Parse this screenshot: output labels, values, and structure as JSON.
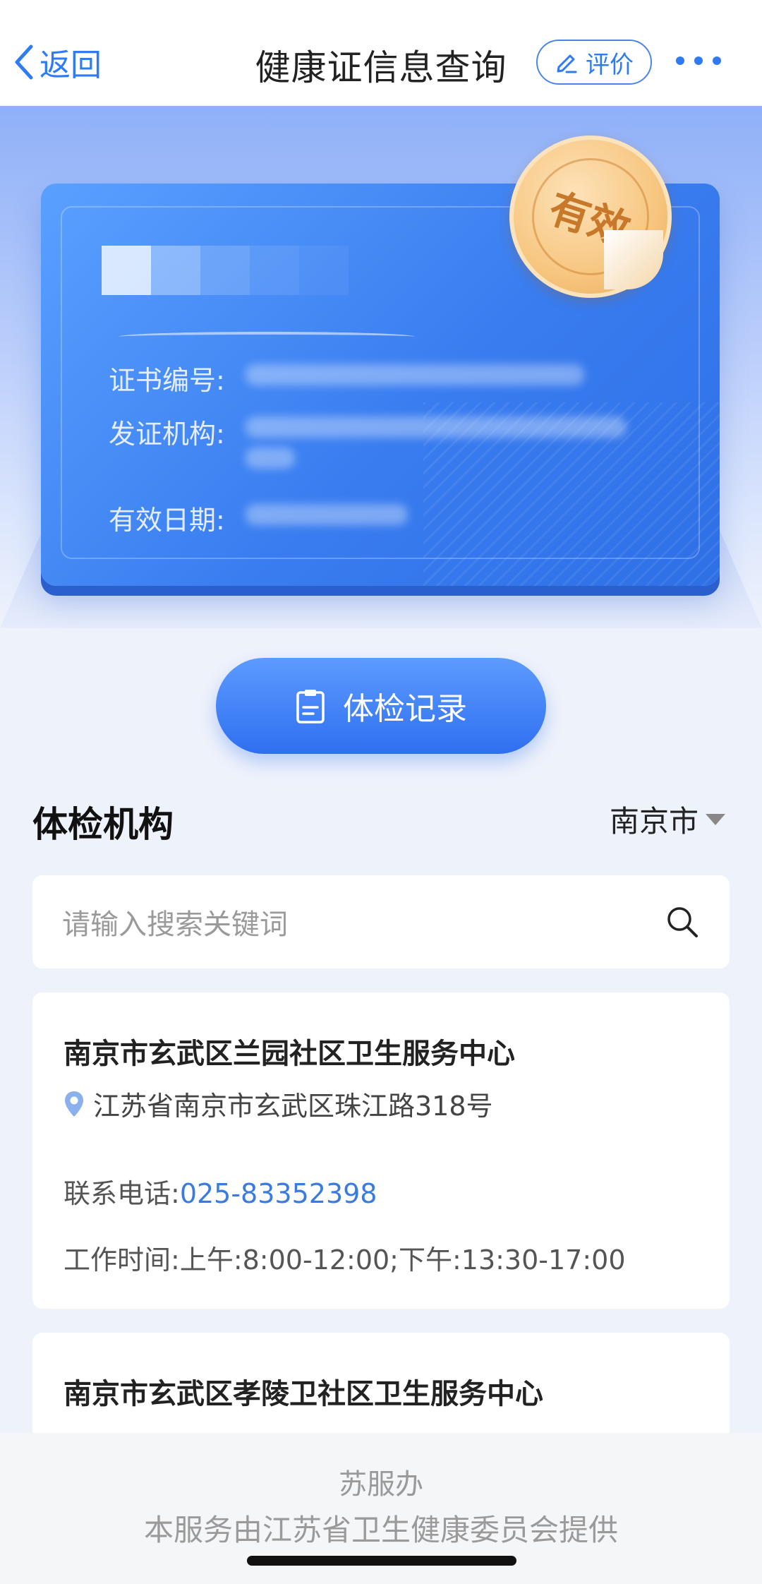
{
  "nav": {
    "back_label": "返回",
    "title": "健康证信息查询",
    "rate_label": "评价"
  },
  "card": {
    "seal_text": "有效",
    "labels": {
      "cert_no": "证书编号:",
      "issuer": "发证机构:",
      "valid_date": "有效日期:"
    }
  },
  "record_button_label": "体检记录",
  "section": {
    "title": "体检机构",
    "city": "南京市"
  },
  "search": {
    "placeholder": "请输入搜索关键词"
  },
  "orgs": [
    {
      "name": "南京市玄武区兰园社区卫生服务中心",
      "address": "江苏省南京市玄武区珠江路318号",
      "phone_label": "联系电话:",
      "phone": "025-83352398",
      "hours_label": "工作时间:",
      "hours": "上午:8:00-12:00;下午:13:30-17:00"
    },
    {
      "name": "南京市玄武区孝陵卫社区卫生服务中心"
    }
  ],
  "footer": {
    "line1": "苏服办",
    "line2": "本服务由江苏省卫生健康委员会提供"
  },
  "colors": {
    "accent": "#2f7bf3",
    "card_blue": "#3a7df0",
    "seal_gold": "#f7c680",
    "phone_link": "#3a7be0"
  }
}
